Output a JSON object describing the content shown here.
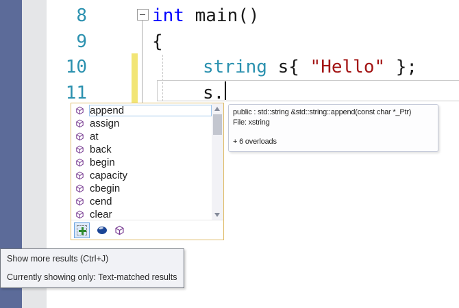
{
  "editor": {
    "lines": [
      {
        "number": "8",
        "indent": 0,
        "tokens": [
          {
            "text": "int",
            "type": "keyword"
          },
          {
            "text": " main()",
            "type": "plain"
          }
        ]
      },
      {
        "number": "9",
        "indent": 0,
        "tokens": [
          {
            "text": "{",
            "type": "plain"
          }
        ]
      },
      {
        "number": "10",
        "indent": 1,
        "tokens": [
          {
            "text": "string",
            "type": "type"
          },
          {
            "text": " s{ ",
            "type": "plain"
          },
          {
            "text": "\"Hello\"",
            "type": "string"
          },
          {
            "text": " };",
            "type": "plain"
          }
        ]
      },
      {
        "number": "11",
        "indent": 1,
        "tokens": [
          {
            "text": "s.",
            "type": "plain"
          }
        ]
      }
    ]
  },
  "completion": {
    "items": [
      "append",
      "assign",
      "at",
      "back",
      "begin",
      "capacity",
      "cbegin",
      "cend",
      "clear"
    ],
    "selected": "append",
    "toolbar": {
      "show_more_icon": "show-more-results",
      "keyword_filter_icon": "keywords-filter",
      "method_filter_icon": "methods-filter"
    }
  },
  "signature_tooltip": {
    "signature": "public : std::string &std::string::append(const char *_Ptr)",
    "file": "File: xstring",
    "overloads": "+ 6 overloads"
  },
  "status_tooltip": {
    "line1": "Show more results (Ctrl+J)",
    "line2": "Currently showing only: Text-matched results"
  },
  "colors": {
    "sidebar_dark": "#5C6B99",
    "sidebar_light": "#E5E6E8",
    "line_number": "#2B91AF",
    "keyword": "#0000FF",
    "type": "#2B91AF",
    "string_lit": "#A31515",
    "code": "#1A1A1A",
    "change_bar": "#F2E575",
    "popup_border": "#DFBD6B",
    "selection_border": "#9EC5EB",
    "tooltip_border": "#C2C7D7",
    "tooltip_bg": "#FDFDFE",
    "status_bg": "#F1F2F6",
    "status_border": "#70757E",
    "scrollbar_bg": "#F2F2F6",
    "scrollbar_thumb": "#C3C6CF",
    "icon_purple": "#7B3F94",
    "icon_green": "#2E8B2E",
    "icon_blue_dark": "#1B4596"
  }
}
